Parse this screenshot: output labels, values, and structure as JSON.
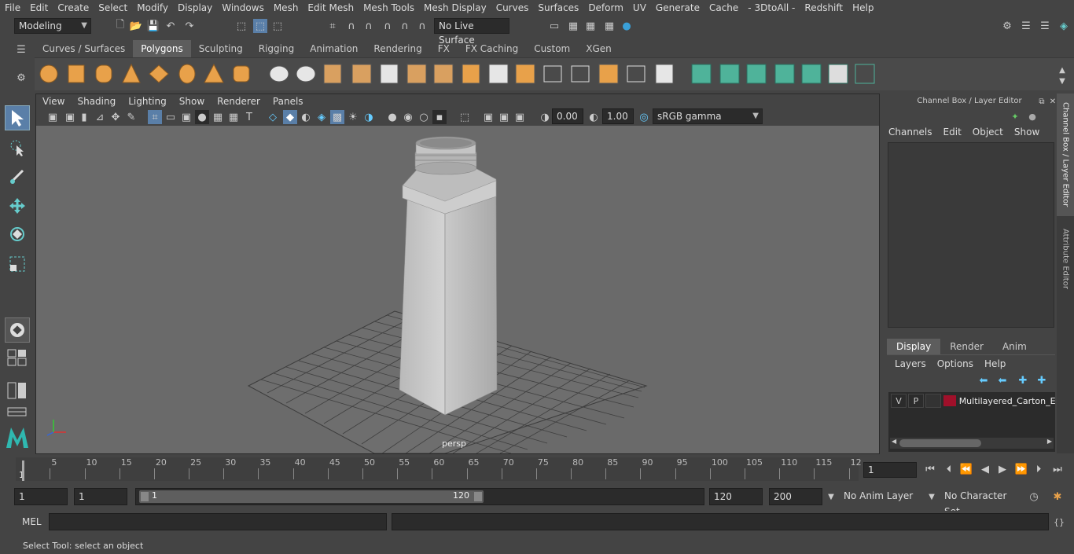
{
  "menubar": {
    "items": [
      "File",
      "Edit",
      "Create",
      "Select",
      "Modify",
      "Display",
      "Windows",
      "Mesh",
      "Edit Mesh",
      "Mesh Tools",
      "Mesh Display",
      "Curves",
      "Surfaces",
      "Deform",
      "UV",
      "Generate",
      "Cache",
      "- 3DtoAll -",
      "Redshift",
      "Help"
    ]
  },
  "status": {
    "mode": "Modeling",
    "live_surface": "No Live Surface"
  },
  "shelf": {
    "tabs": [
      "Curves / Surfaces",
      "Polygons",
      "Sculpting",
      "Rigging",
      "Animation",
      "Rendering",
      "FX",
      "FX Caching",
      "Custom",
      "XGen"
    ],
    "active_tab": "Polygons"
  },
  "viewport": {
    "menu": [
      "View",
      "Shading",
      "Lighting",
      "Show",
      "Renderer",
      "Panels"
    ],
    "exposure": "0.00",
    "gamma": "1.00",
    "color_space": "sRGB gamma",
    "camera_label": "persp"
  },
  "channel_box": {
    "title": "Channel Box / Layer Editor",
    "menu": [
      "Channels",
      "Edit",
      "Object",
      "Show"
    ],
    "layer_tabs": [
      "Display",
      "Render",
      "Anim"
    ],
    "active_layer_tab": "Display",
    "layer_menu": [
      "Layers",
      "Options",
      "Help"
    ],
    "layer": {
      "v": "V",
      "p": "P",
      "color": "#a0102a",
      "name": "Multilayered_Carton_E"
    }
  },
  "side_tabs": [
    "Channel Box / Layer Editor",
    "Attribute Editor"
  ],
  "timeline": {
    "ticks": [
      "5",
      "10",
      "15",
      "20",
      "25",
      "30",
      "35",
      "40",
      "45",
      "50",
      "55",
      "60",
      "65",
      "70",
      "75",
      "80",
      "85",
      "90",
      "95",
      "100",
      "105",
      "110",
      "115",
      "12"
    ],
    "start_label": "1",
    "current_frame": "1"
  },
  "range": {
    "start": "1",
    "playback_start": "1",
    "slider_start": "1",
    "slider_end": "120",
    "playback_end": "120",
    "end": "200",
    "anim_layer": "No Anim Layer",
    "character_set": "No Character Set"
  },
  "command": {
    "label": "MEL"
  },
  "help": {
    "text": "Select Tool: select an object"
  },
  "colors": {
    "accent_orange": "#e8a14a",
    "accent_teal": "#4fb39a",
    "active_tab": "#5d5d5d"
  }
}
